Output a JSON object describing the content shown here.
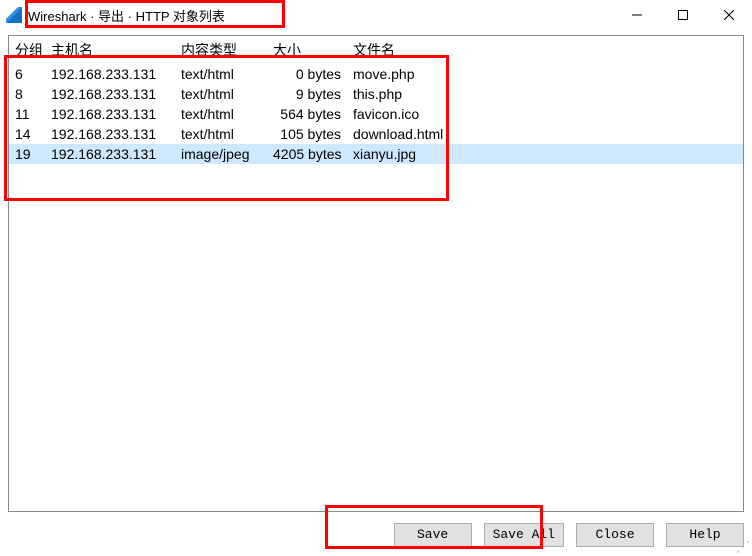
{
  "title": "Wireshark · 导出 · HTTP 对象列表",
  "columns": {
    "packet": "分组",
    "hostname": "主机名",
    "content_type": "内容类型",
    "size": "大小",
    "filename": "文件名"
  },
  "rows": [
    {
      "packet": "6",
      "hostname": "192.168.233.131",
      "content_type": "text/html",
      "size": "0 bytes",
      "filename": "move.php",
      "selected": false
    },
    {
      "packet": "8",
      "hostname": "192.168.233.131",
      "content_type": "text/html",
      "size": "9 bytes",
      "filename": "this.php",
      "selected": false
    },
    {
      "packet": "11",
      "hostname": "192.168.233.131",
      "content_type": "text/html",
      "size": "564 bytes",
      "filename": "favicon.ico",
      "selected": false
    },
    {
      "packet": "14",
      "hostname": "192.168.233.131",
      "content_type": "text/html",
      "size": "105 bytes",
      "filename": "download.html",
      "selected": false
    },
    {
      "packet": "19",
      "hostname": "192.168.233.131",
      "content_type": "image/jpeg",
      "size": "4205 bytes",
      "filename": "xianyu.jpg",
      "selected": true
    }
  ],
  "buttons": {
    "save": "Save",
    "save_all": "Save All",
    "close": "Close",
    "help": "Help"
  }
}
